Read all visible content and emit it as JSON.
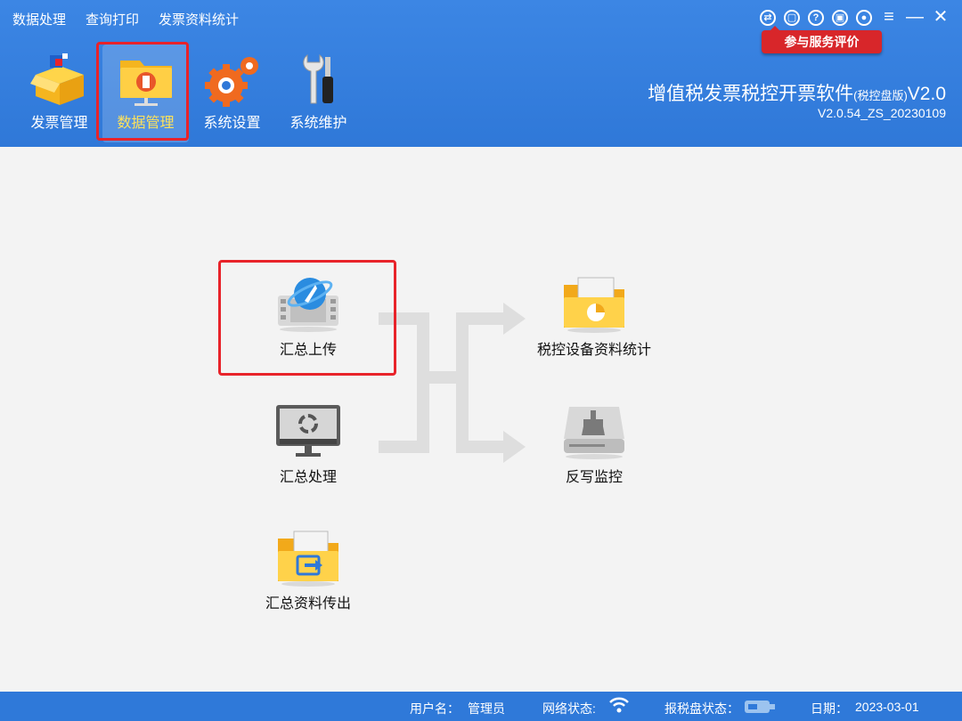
{
  "top_menu": [
    "数据处理",
    "查询打印",
    "发票资料统计"
  ],
  "window_controls": [
    "switch-icon",
    "feedback-icon",
    "help-icon",
    "lock-icon",
    "user-icon",
    "menu-icon",
    "minimize-icon",
    "close-icon"
  ],
  "service_eval_label": "参与服务评价",
  "toolbar": [
    {
      "label": "发票管理",
      "icon": "box-icon",
      "active": false
    },
    {
      "label": "数据管理",
      "icon": "folder-data-icon",
      "active": true
    },
    {
      "label": "系统设置",
      "icon": "gear-icon",
      "active": false
    },
    {
      "label": "系统维护",
      "icon": "wrench-icon",
      "active": false
    }
  ],
  "app": {
    "title_main": "增值税发票税控开票软件",
    "title_edition": "(税控盘版)",
    "title_suffix": "V2.0",
    "version": "V2.0.54_ZS_20230109"
  },
  "functions": {
    "upload": "汇总上传",
    "process": "汇总处理",
    "export": "汇总资料传出",
    "stats": "税控设备资料统计",
    "writeback": "反写监控"
  },
  "status": {
    "user_label": "用户名：",
    "user_value": "管理员",
    "network_label": "网络状态:",
    "disk_label": "报税盘状态：",
    "date_label": "日期：",
    "date_value": "2023-03-01"
  },
  "colors": {
    "header": "#2f78d8",
    "highlight": "#e8232a",
    "eval_button": "#d8262a"
  }
}
